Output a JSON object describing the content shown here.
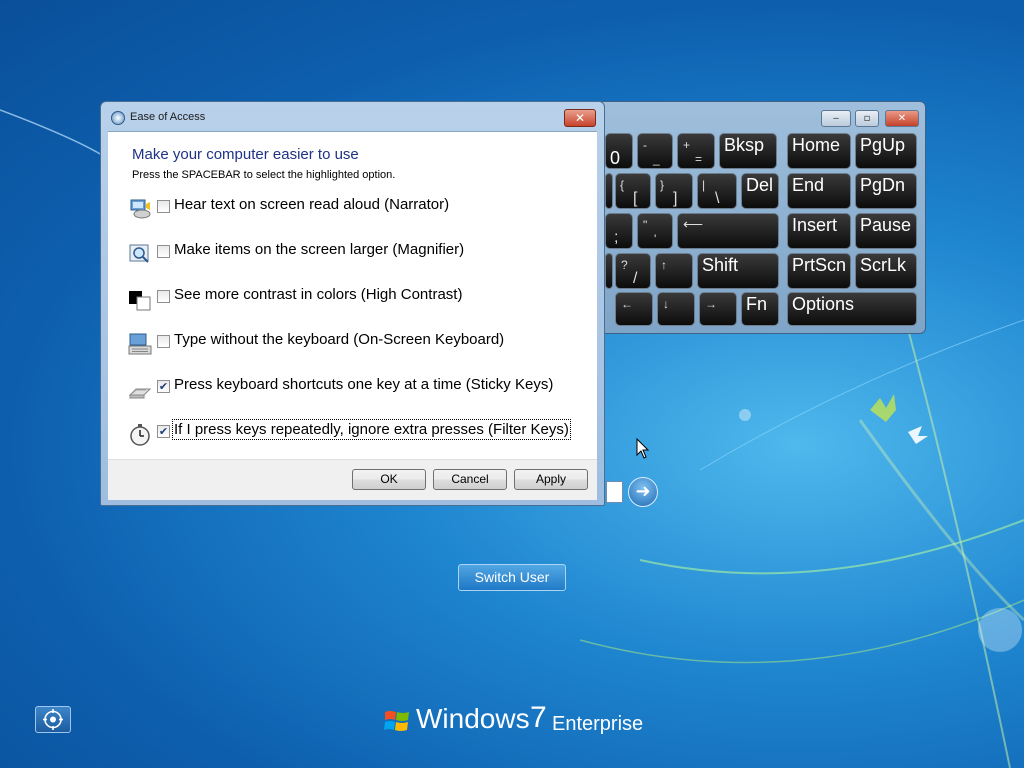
{
  "osk": {
    "keys": {
      "k0": "0",
      "minus": "-",
      "minus_shift": "_",
      "equals": "=",
      "equals_shift": "+",
      "bksp": "Bksp",
      "home": "Home",
      "pgup": "PgUp",
      "lbracket": "[",
      "lbracket_shift": "{",
      "rbracket": "]",
      "rbracket_shift": "}",
      "backslash": "\\",
      "backslash_shift": "|",
      "del": "Del",
      "end": "End",
      "pgdn": "PgDn",
      "semicolon": ";",
      "quote": "'",
      "quote_shift": "\"",
      "insert": "Insert",
      "pause": "Pause",
      "slash": "/",
      "slash_shift": "?",
      "up": "↑",
      "shift": "Shift",
      "prtscn": "PrtScn",
      "scrlk": "ScrLk",
      "left": "←",
      "down": "↓",
      "right": "→",
      "fn": "Fn",
      "options": "Options"
    }
  },
  "dialog": {
    "title": "Ease of Access",
    "close_label": "✕",
    "heading": "Make your computer easier to use",
    "instruction": "Press the SPACEBAR to select the highlighted option.",
    "options": [
      {
        "label": "Hear text on screen read aloud (Narrator)",
        "checked": false,
        "icon": "narrator-icon"
      },
      {
        "label": "Make items on the screen larger (Magnifier)",
        "checked": false,
        "icon": "magnifier-icon"
      },
      {
        "label": "See more contrast in colors (High Contrast)",
        "checked": false,
        "icon": "high-contrast-icon"
      },
      {
        "label": "Type without the keyboard (On-Screen Keyboard)",
        "checked": false,
        "icon": "on-screen-keyboard-icon"
      },
      {
        "label": "Press keyboard shortcuts one key at a time (Sticky Keys)",
        "checked": true,
        "icon": "sticky-keys-icon"
      },
      {
        "label": "If I press keys repeatedly, ignore extra presses (Filter Keys)",
        "checked": true,
        "icon": "filter-keys-icon"
      }
    ],
    "buttons": {
      "ok": "OK",
      "cancel": "Cancel",
      "apply": "Apply"
    }
  },
  "login": {
    "switch_user": "Switch User",
    "submit_arrow": "➜"
  },
  "branding": {
    "name": "Windows",
    "version": "7",
    "edition": "Enterprise"
  }
}
